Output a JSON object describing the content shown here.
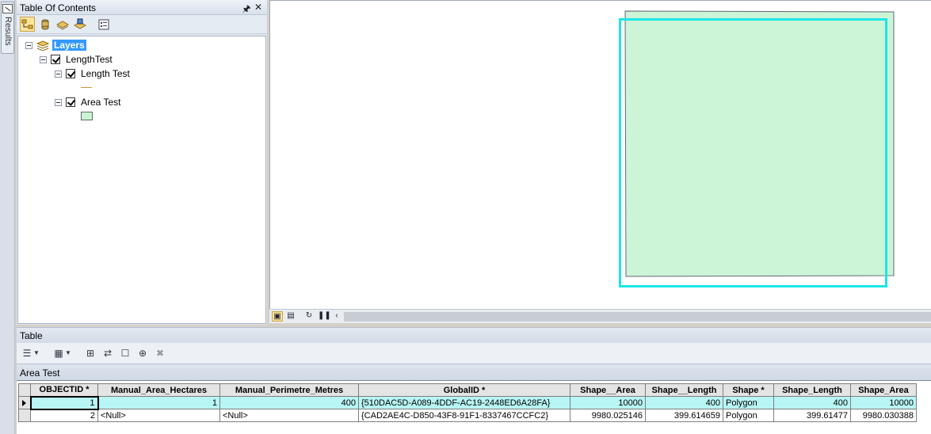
{
  "results_tab": {
    "label": "Results"
  },
  "toc": {
    "title": "Table Of Contents",
    "pin_icon": "pin-icon",
    "close_icon": "close-icon",
    "toolbar_icons": [
      "list-by-drawing-order-icon",
      "list-by-source-icon",
      "list-by-visibility-icon",
      "list-by-selection-icon",
      "options-icon"
    ],
    "tree": {
      "root": "Layers",
      "group": "LengthTest",
      "layers": [
        {
          "name": "Length Test",
          "symbol": "line",
          "color": "#d19a3a"
        },
        {
          "name": "Area Test",
          "symbol": "polygon",
          "color": "#ccf4d6"
        }
      ]
    }
  },
  "map": {
    "polygon_fill": "#ccf4d6",
    "selection_color": "#1ce6e6",
    "bottom_icons": [
      "data-view-icon",
      "layout-view-icon",
      "refresh-icon",
      "pause-icon",
      "scroll-left-icon"
    ]
  },
  "table_window": {
    "title": "Table",
    "tab_name": "Area Test",
    "toolbar_icons": [
      "table-options-icon",
      "related-tables-icon",
      "select-by-attributes-icon",
      "switch-selection-icon",
      "clear-selection-icon",
      "zoom-to-selected-icon",
      "delete-selected-icon"
    ],
    "columns": [
      "OBJECTID *",
      "Manual_Area_Hectares",
      "Manual_Perimetre_Metres",
      "GlobalID *",
      "Shape__Area",
      "Shape__Length",
      "Shape *",
      "Shape_Length",
      "Shape_Area"
    ],
    "rows": [
      [
        "1",
        "1",
        "400",
        "{510DAC5D-A089-4DDF-AC19-2448ED6A28FA}",
        "10000",
        "400",
        "Polygon",
        "400",
        "10000"
      ],
      [
        "2",
        "<Null>",
        "<Null>",
        "{CAD2AE4C-D850-43F8-91F1-8337467CCFC2}",
        "9980.025146",
        "399.614659",
        "Polygon",
        "399.61477",
        "9980.030388"
      ]
    ],
    "selected_row": 0
  }
}
